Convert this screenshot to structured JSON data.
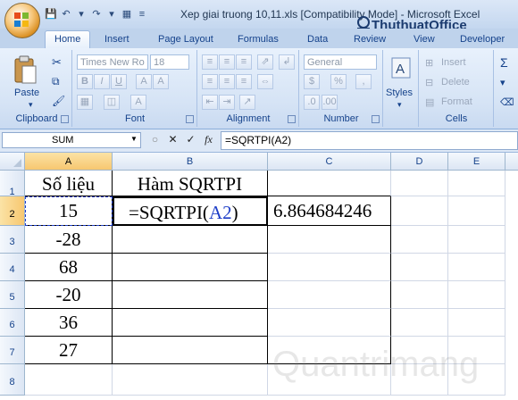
{
  "window": {
    "title": "Xep giai truong 10,11.xls  [Compatibility Mode] - Microsoft Excel"
  },
  "tabs": [
    "Home",
    "Insert",
    "Page Layout",
    "Formulas",
    "Data",
    "Review",
    "View",
    "Developer"
  ],
  "ribbon": {
    "font_name": "Times New Ro",
    "font_size": "18",
    "number_format": "General",
    "paste_label": "Paste",
    "styles_label": "Styles",
    "insert_label": "Insert",
    "delete_label": "Delete",
    "format_label": "Format",
    "groups": {
      "clipboard": "Clipboard",
      "font": "Font",
      "alignment": "Alignment",
      "number": "Number",
      "cells": "Cells"
    }
  },
  "formula_bar": {
    "name_box": "SUM",
    "formula": "=SQRTPI(A2)"
  },
  "sheet": {
    "columns": [
      "A",
      "B",
      "C",
      "D",
      "E"
    ],
    "rows": [
      "1",
      "2",
      "3",
      "4",
      "5",
      "6",
      "7",
      "8"
    ],
    "cells": {
      "A1": "Số liệu",
      "B1": "Hàm SQRTPI",
      "A2": "15",
      "B2_prefix": "=SQRTPI(",
      "B2_ref": "A2",
      "B2_suffix": ")",
      "C2": "6.864684246",
      "A3": "-28",
      "A4": "68",
      "A5": "-20",
      "A6": "36",
      "A7": "27"
    }
  },
  "watermarks": {
    "top": "ThuthuatOffice",
    "bottom": "Quantrimang"
  },
  "colors": {
    "accent": "#15428b",
    "reference": "#1f3fc8",
    "ribbon_bg": "#d5e3f5"
  }
}
